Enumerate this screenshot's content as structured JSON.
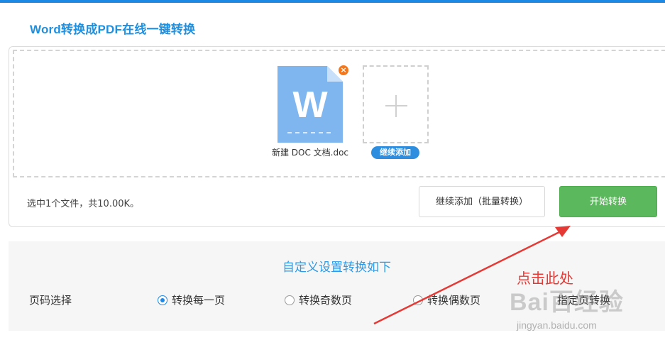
{
  "page_title": "Word转换成PDF在线一键转换",
  "file": {
    "icon_letter": "W",
    "name": "新建 DOC 文档.doc",
    "remove_symbol": "×"
  },
  "add_more_pill": "继续添加",
  "status_text": "选中1个文件，共10.00K。",
  "buttons": {
    "batch_add": "继续添加（批量转换）",
    "start_convert": "开始转换"
  },
  "settings": {
    "title": "自定义设置转换如下",
    "page_select_label": "页码选择",
    "options": [
      {
        "label": "转换每一页",
        "checked": true
      },
      {
        "label": "转换奇数页",
        "checked": false
      },
      {
        "label": "转换偶数页",
        "checked": false
      },
      {
        "label": "指定页转换",
        "checked": false
      }
    ]
  },
  "annotation_text": "点击此处",
  "watermark": {
    "logo": "Bai百经验",
    "url": "jingyan.baidu.com"
  },
  "colors": {
    "accent_blue": "#1e88e5",
    "start_green": "#5cb85c",
    "annotation_red": "#e53935",
    "badge_orange": "#f5771c"
  }
}
